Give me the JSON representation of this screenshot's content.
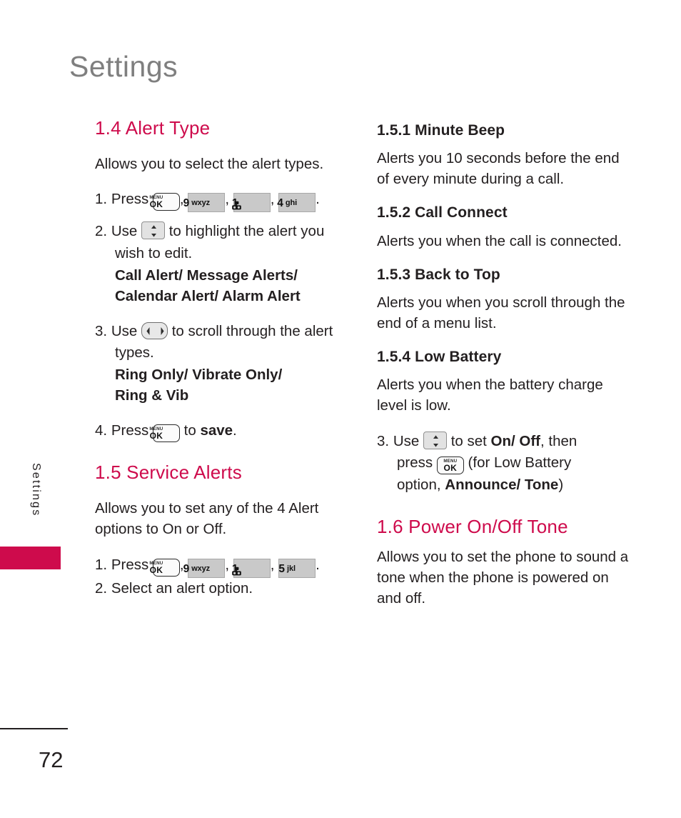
{
  "page": {
    "title": "Settings",
    "side_tab_label": "Settings",
    "page_number": "72"
  },
  "colors": {
    "heading_crimson": "#ce0b4c",
    "title_gray": "#7f7f7f",
    "body_black": "#231f20",
    "key_gray": "#c9c9c9"
  },
  "keys": {
    "menu_ok": {
      "top": "MENU",
      "bottom": "OK",
      "name": "menu-ok-key"
    },
    "nine": {
      "digit": "9",
      "letters": "wxyz"
    },
    "one": {
      "digit": "1",
      "letters": "",
      "glyph": "voicemail-icon"
    },
    "four": {
      "digit": "4",
      "letters": "ghi"
    },
    "five": {
      "digit": "5",
      "letters": "jkl"
    },
    "up_down": {
      "name": "up-down-navigation-key"
    },
    "left_right": {
      "name": "left-right-navigation-key"
    }
  },
  "left_column": {
    "section_1_4": {
      "heading": "1.4 Alert  Type",
      "body": "Allows you to select the alert types.",
      "step1": {
        "num": "1.",
        "text_before": "Press",
        "comma1": ",",
        "comma2": ",",
        "comma3": ",",
        "period": "."
      },
      "step2": {
        "num": "2.",
        "text_before": "Use",
        "text_after": "to highlight the alert you wish to edit.",
        "options_line1": "Call Alert/ Message Alerts/",
        "options_line2": "Calendar Alert/ Alarm Alert"
      },
      "step3": {
        "num": "3.",
        "text_before": "Use",
        "text_after": "to scroll through the alert types.",
        "options_line1": "Ring Only/ Vibrate Only/",
        "options_line2": "Ring & Vib"
      },
      "step4": {
        "num": "4.",
        "text_before": "Press",
        "text_mid": "to",
        "bold_word": "save",
        "period": "."
      }
    },
    "section_1_5": {
      "heading": "1.5 Service Alerts",
      "body": "Allows you to set any of the 4 Alert options to On or Off.",
      "step1": {
        "num": "1.",
        "text_before": "Press",
        "comma1": ",",
        "comma2": ",",
        "comma3": ",",
        "period": "."
      },
      "step2": {
        "num": "2.",
        "text": "Select an alert option."
      }
    }
  },
  "right_column": {
    "sub_1_5_1": {
      "heading": "1.5.1 Minute Beep",
      "body": "Alerts you 10 seconds before the end of every minute during a call."
    },
    "sub_1_5_2": {
      "heading": "1.5.2 Call Connect",
      "body": "Alerts you when the call is connected."
    },
    "sub_1_5_3": {
      "heading": "1.5.3 Back to Top",
      "body": "Alerts you when you scroll through the end of a menu list."
    },
    "sub_1_5_4": {
      "heading": "1.5.4 Low Battery",
      "body": "Alerts you when the battery charge level is low."
    },
    "step3": {
      "num": "3.",
      "t1": "Use",
      "t2": "to set",
      "b1": "On/ Off",
      "t3": ", then",
      "t4": "press",
      "t5": "(for Low Battery",
      "t6": "option,",
      "b2": "Announce/ Tone",
      "t7": ")"
    },
    "section_1_6": {
      "heading": "1.6 Power On/Off Tone",
      "body": "Allows you to set the phone to sound a tone when the phone is powered on and off."
    }
  }
}
